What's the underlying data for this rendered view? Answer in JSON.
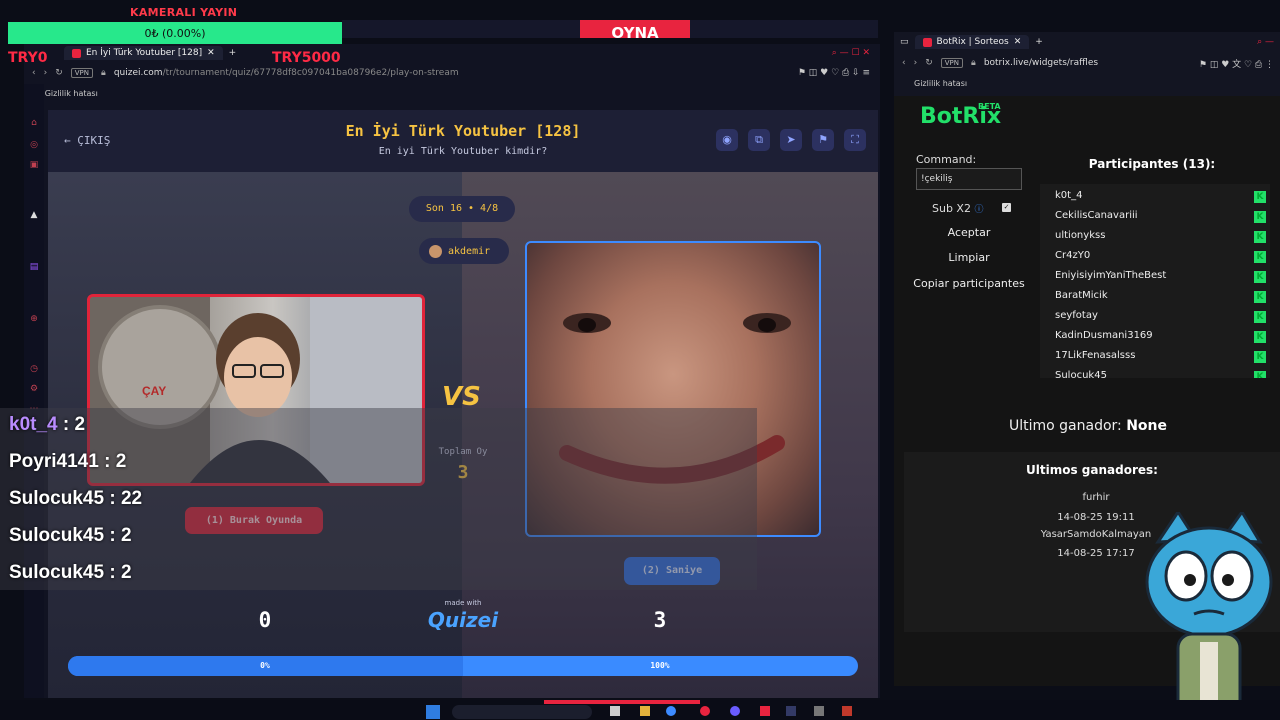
{
  "overlay": {
    "stream_label": "KAMERALI YAYIN",
    "goal_text": "0₺ (0.00%)",
    "try_left": "TRY0",
    "try_right": "TRY5000",
    "game_banner": "OYNA"
  },
  "left_browser": {
    "tab_title": "En İyi Türk Youtuber [128]",
    "vpn": "VPN",
    "url_host": "quizei.com",
    "url_path": "/tr/tournament/quiz/67778df8c097041ba08796e2/play-on-stream",
    "privacy_error": "Gizlilik hatası"
  },
  "quiz": {
    "exit_label": "← ÇIKIŞ",
    "title": "En İyi Türk Youtuber [128]",
    "subtitle": "En iyi Türk Youtuber kimdir?",
    "round": "Son 16 • 4/8",
    "author": "akdemir",
    "vs": "VS",
    "total_votes_label": "Toplam Oy",
    "total_votes": "3",
    "option_left": "(1) Burak Oyunda",
    "option_right": "(2) Saniye",
    "score_left": "0",
    "score_right": "3",
    "made_with": "made with",
    "brand": "Quizei",
    "percent_left": "0%",
    "percent_right": "100%",
    "left_share": 0.5,
    "photo_label": "ÇAY"
  },
  "leaderboard": [
    {
      "name": "k0t_4",
      "score": "2",
      "color": "#b98cff"
    },
    {
      "name": "Poyri4141",
      "score": "2",
      "color": "#ffffff"
    },
    {
      "name": "Sulocuk45",
      "score": "22",
      "color": "#ffffff"
    },
    {
      "name": "Sulocuk45",
      "score": "2",
      "color": "#ffffff"
    },
    {
      "name": "Sulocuk45",
      "score": "2",
      "color": "#ffffff"
    }
  ],
  "right_browser": {
    "tab_title": "BotRix | Sorteos",
    "vpn": "VPN",
    "url": "botrix.live/widgets/raffles",
    "privacy_error": "Gizlilik hatası"
  },
  "botrix": {
    "logo": "BotRix",
    "beta": "BETA",
    "command_label": "Command:",
    "command_value": "!çekiliş",
    "sub_label": "Sub X2",
    "sub_checked": "✓",
    "accept": "Aceptar",
    "clear": "Limpiar",
    "copy": "Copiar participantes",
    "participants_title": "Participantes (13):",
    "participants": [
      "k0t_4",
      "CekilisCanavariii",
      "ultionykss",
      "Cr4zY0",
      "EniyisiyimYaniTheBest",
      "BaratMicik",
      "seyfotay",
      "KadinDusmani3169",
      "17LikFenasalsss",
      "Sulocuk45"
    ],
    "last_winner_label": "Ultimo ganador:",
    "last_winner": "None",
    "winners_title": "Ultimos ganadores:",
    "winners": [
      "furhir",
      "14-08-25 19:11",
      "YasarSamdoKalmayan",
      "14-08-25 17:17"
    ]
  },
  "colors": {
    "accent_gold": "#f6c342",
    "red": "#e0243a",
    "blue": "#3d8bff",
    "green": "#22e069"
  }
}
